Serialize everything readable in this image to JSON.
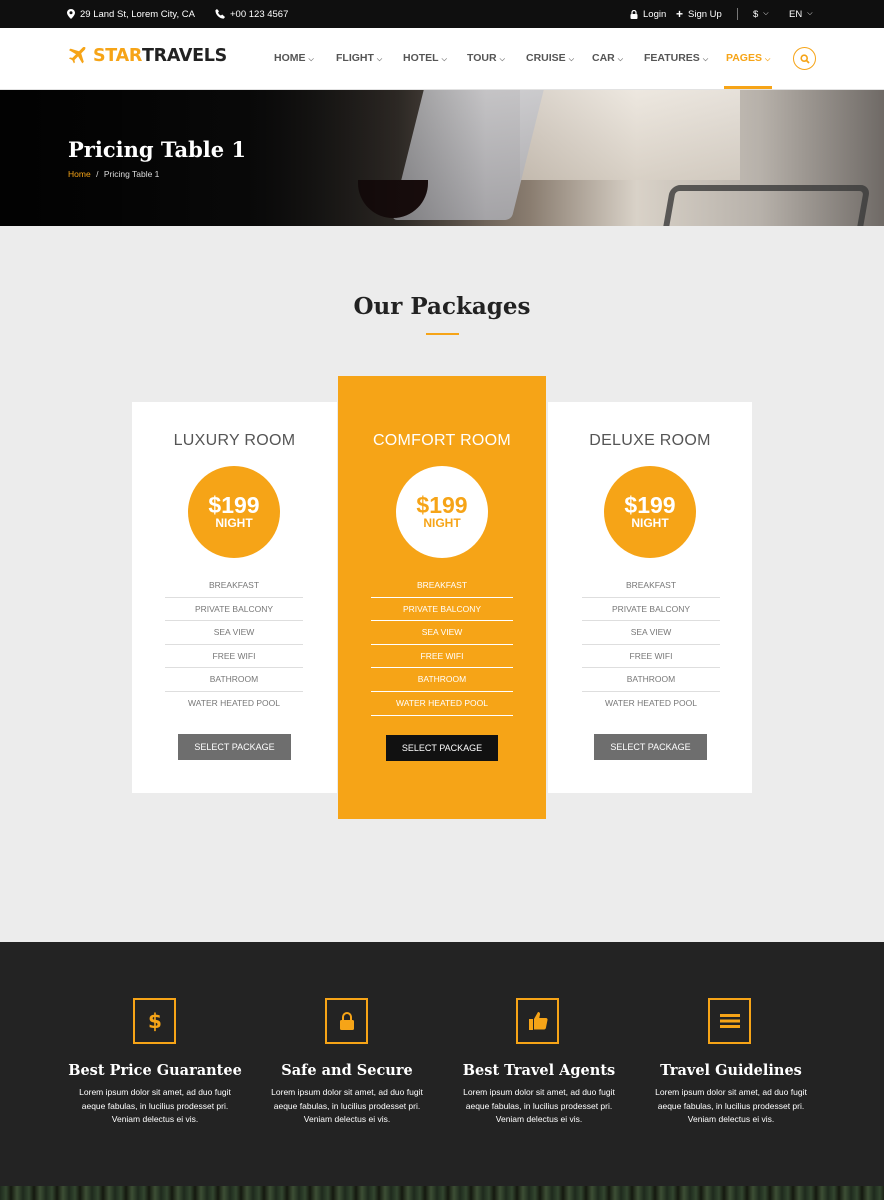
{
  "topbar": {
    "address": "29 Land St, Lorem City, CA",
    "phone": "+00 123 4567",
    "login": "Login",
    "signup": "Sign Up",
    "currency": "$",
    "language": "EN"
  },
  "logo": {
    "part1": "STAR",
    "part2": "TRAVELS"
  },
  "nav": {
    "items": [
      {
        "label": "HOME"
      },
      {
        "label": "FLIGHT"
      },
      {
        "label": "HOTEL"
      },
      {
        "label": "TOUR"
      },
      {
        "label": "CRUISE"
      },
      {
        "label": "CAR"
      },
      {
        "label": "FEATURES"
      },
      {
        "label": "PAGES"
      }
    ],
    "active": "PAGES"
  },
  "hero": {
    "title": "Pricing Table 1",
    "breadcrumb": {
      "home": "Home",
      "separator": "/",
      "current": "Pricing Table 1"
    }
  },
  "section": {
    "title": "Our Packages"
  },
  "packages": [
    {
      "name": "LUXURY ROOM",
      "price": "$199",
      "per": "NIGHT",
      "features": [
        "BREAKFAST",
        "PRIVATE BALCONY",
        "SEA VIEW",
        "FREE WIFI",
        "BATHROOM",
        "WATER HEATED POOL"
      ],
      "button": "SELECT PACKAGE",
      "featured": false
    },
    {
      "name": "COMFORT ROOM",
      "price": "$199",
      "per": "NIGHT",
      "features": [
        "BREAKFAST",
        "PRIVATE BALCONY",
        "SEA VIEW",
        "FREE WIFI",
        "BATHROOM",
        "WATER HEATED POOL"
      ],
      "button": "SELECT PACKAGE",
      "featured": true
    },
    {
      "name": "DELUXE ROOM",
      "price": "$199",
      "per": "NIGHT",
      "features": [
        "BREAKFAST",
        "PRIVATE BALCONY",
        "SEA VIEW",
        "FREE WIFI",
        "BATHROOM",
        "WATER HEATED POOL"
      ],
      "button": "SELECT PACKAGE",
      "featured": false
    }
  ],
  "features": [
    {
      "icon": "dollar-icon",
      "title": "Best Price Guarantee",
      "line1": "Lorem ipsum dolor sit amet, ad duo fugit",
      "line2": "aeque fabulas, in lucilius prodesset pri.",
      "line3": "Veniam delectus ei vis."
    },
    {
      "icon": "lock-icon",
      "title": "Safe and Secure",
      "line1": "Lorem ipsum dolor sit amet, ad duo fugit",
      "line2": "aeque fabulas, in lucilius prodesset pri.",
      "line3": "Veniam delectus ei vis."
    },
    {
      "icon": "thumbs-up-icon",
      "title": "Best Travel Agents",
      "line1": "Lorem ipsum dolor sit amet, ad duo fugit",
      "line2": "aeque fabulas, in lucilius prodesset pri.",
      "line3": "Veniam delectus ei vis."
    },
    {
      "icon": "list-icon",
      "title": "Travel Guidelines",
      "line1": "Lorem ipsum dolor sit amet, ad duo fugit",
      "line2": "aeque fabulas, in lucilius prodesset pri.",
      "line3": "Veniam delectus ei vis."
    }
  ],
  "colors": {
    "accent": "#f6a417",
    "dark": "#232323",
    "topbar": "#0f0f0f",
    "background": "#ececec"
  }
}
